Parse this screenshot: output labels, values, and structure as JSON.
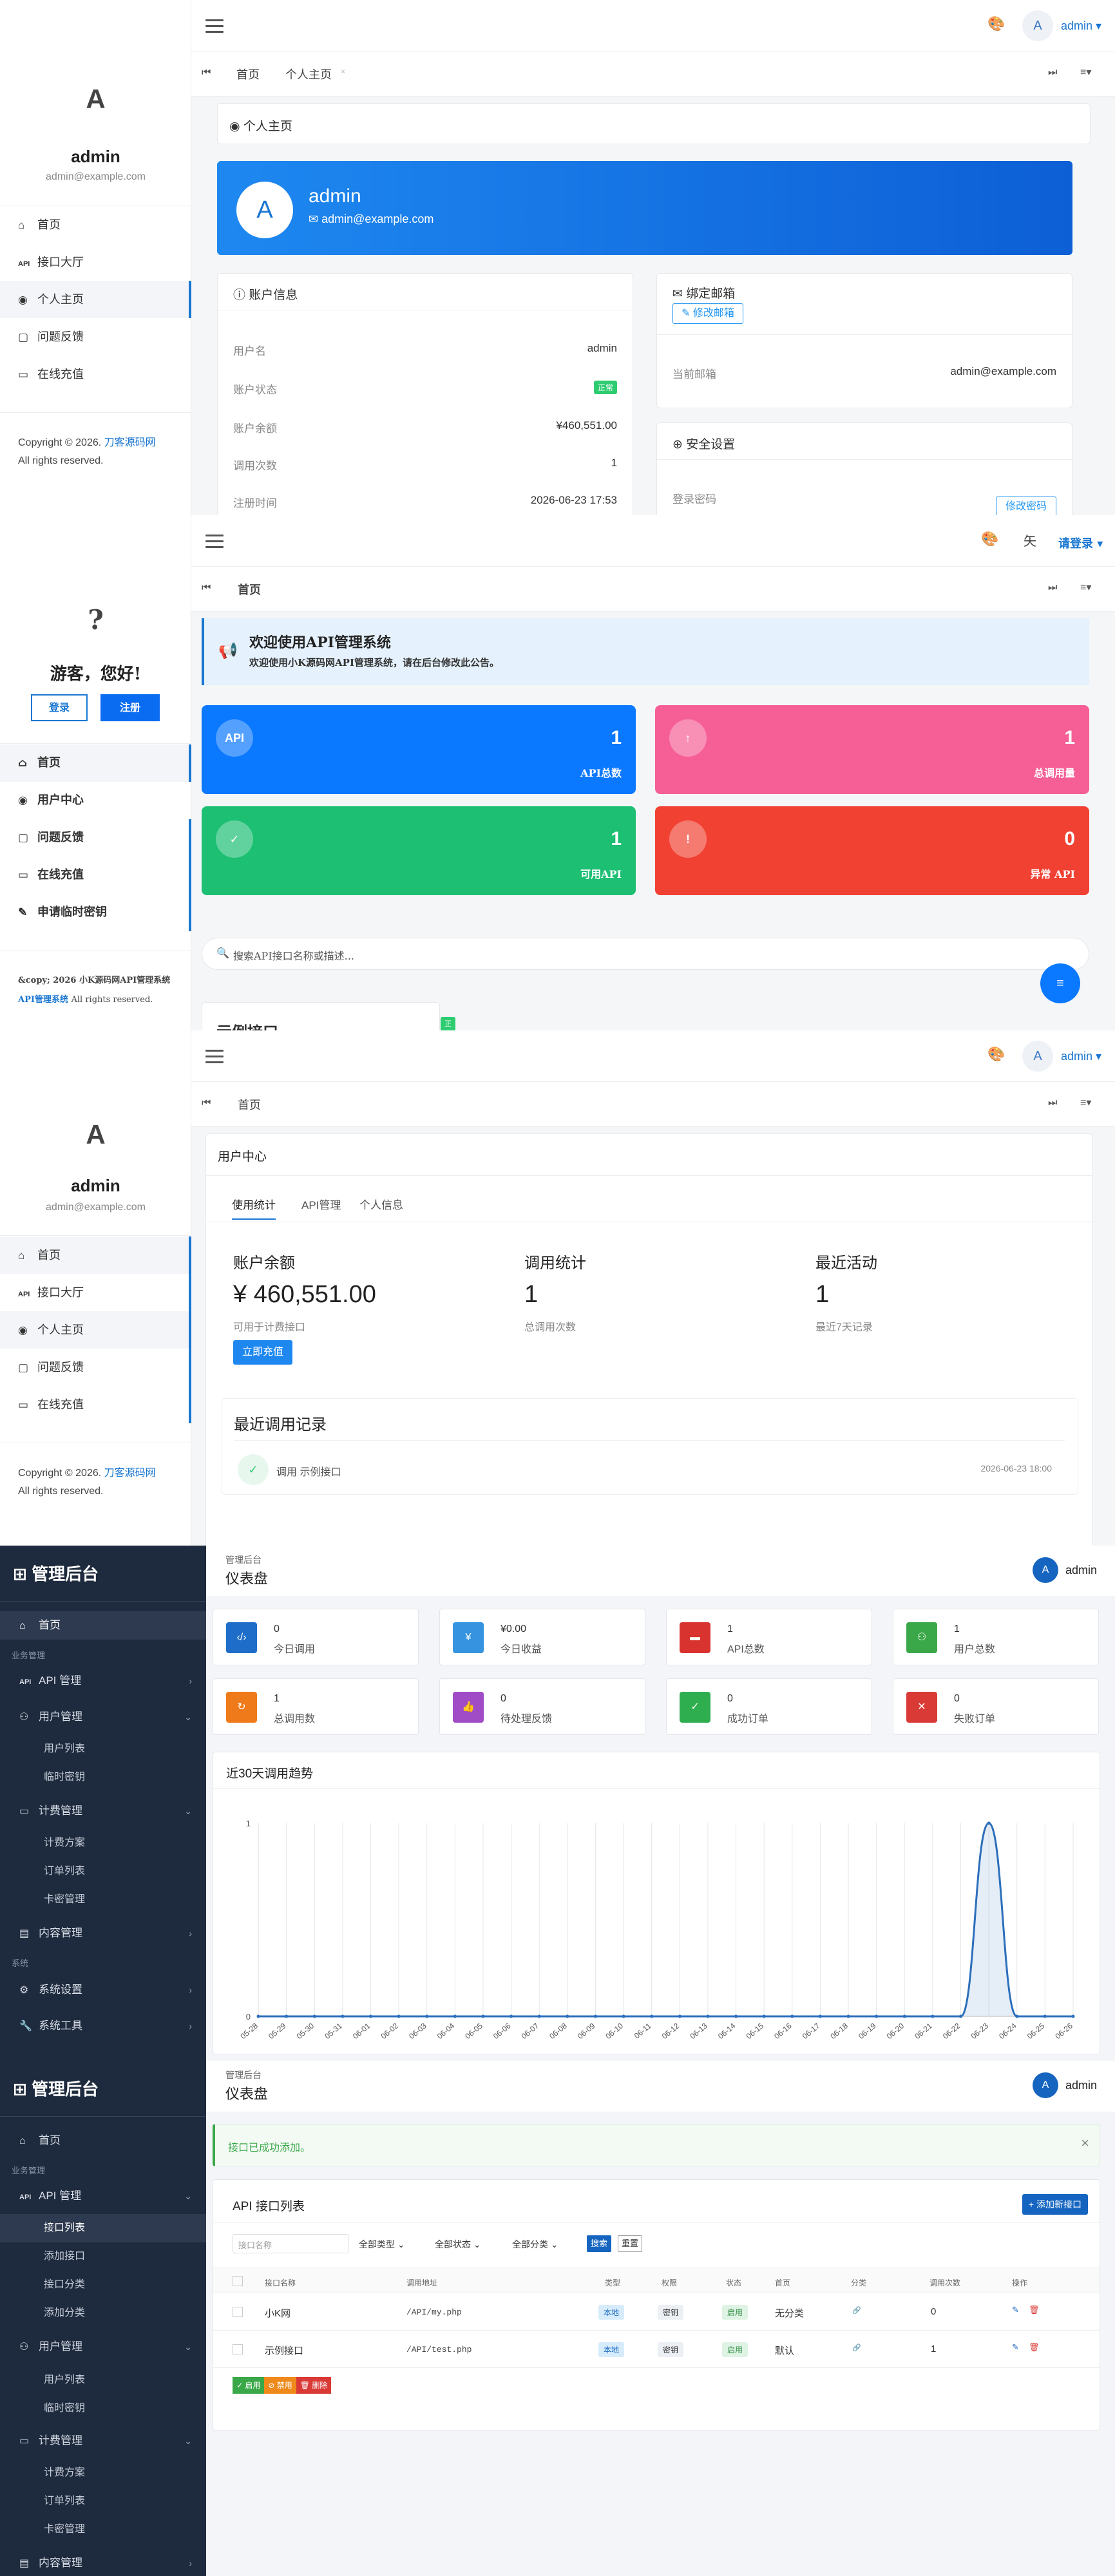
{
  "p1": {
    "side": {
      "avatar": "A",
      "name": "admin",
      "email": "admin@example.com",
      "nav": [
        {
          "icon": "⌂",
          "label": "首页"
        },
        {
          "icon": "API",
          "label": "接口大厅"
        },
        {
          "icon": "◉",
          "label": "个人主页"
        },
        {
          "icon": "▢",
          "label": "问题反馈"
        },
        {
          "icon": "▭",
          "label": "在线充值"
        }
      ],
      "footer_text": "Copyright © 2026.",
      "footer_link": "刀客源码网",
      "footer_rights": "All rights reserved."
    },
    "top": {
      "avatar": "A",
      "user": "admin ▾"
    },
    "tabs": [
      "首页",
      "个人主页"
    ],
    "page_title": "◉ 个人主页",
    "banner": {
      "avatar": "A",
      "name": "admin",
      "email": "✉ admin@example.com"
    },
    "account": {
      "title": "ⓘ 账户信息",
      "rows": [
        {
          "k": "用户名",
          "v": "admin"
        },
        {
          "k": "账户状态",
          "v": "正常"
        },
        {
          "k": "账户余额",
          "v": "¥460,551.00"
        },
        {
          "k": "调用次数",
          "v": "1"
        },
        {
          "k": "注册时间",
          "v": "2026-06-23 17:53"
        }
      ]
    },
    "email_card": {
      "title": "✉ 绑定邮箱",
      "btn": "✎ 修改邮箱",
      "k": "当前邮箱",
      "v": "admin@example.com"
    },
    "security": {
      "title": "⊕ 安全设置",
      "k": "登录密码",
      "btn": "修改密码"
    }
  },
  "p2": {
    "side": {
      "avatar": "?",
      "greet": "游客，您好!",
      "login": "登录",
      "register": "注册",
      "nav": [
        {
          "icon": "⌂",
          "label": "首页"
        },
        {
          "icon": "◉",
          "label": "用户中心"
        },
        {
          "icon": "▢",
          "label": "问题反馈"
        },
        {
          "icon": "▭",
          "label": "在线充值"
        },
        {
          "icon": "✎",
          "label": "申请临时密钥"
        }
      ],
      "footer_text": "&copy; 2026 小K源码网API管理系统",
      "footer_link": "API管理系统",
      "footer_rights": "All rights reserved."
    },
    "top": {
      "login": "请登录 ▾",
      "char": "矢"
    },
    "tabs": [
      "首页"
    ],
    "notice": {
      "title": "欢迎使用API管理系统",
      "text": "欢迎使用小K源码网API管理系统，请在后台修改此公告。"
    },
    "stats": [
      {
        "icon": "API",
        "value": "1",
        "label": "API总数",
        "color": "#0a78ff"
      },
      {
        "icon": "↑",
        "value": "1",
        "label": "总调用量",
        "color": "#f55f95"
      },
      {
        "icon": "✓",
        "value": "1",
        "label": "可用API",
        "color": "#1dbf73"
      },
      {
        "icon": "!",
        "value": "0",
        "label": "异常 API",
        "color": "#f14133"
      }
    ],
    "search_placeholder": "搜索API接口名称或描述...",
    "partial_card": {
      "title": "示例接口",
      "tag": "正常"
    }
  },
  "p3": {
    "side": {
      "avatar": "A",
      "name": "admin",
      "email": "admin@example.com",
      "nav": [
        {
          "icon": "⌂",
          "label": "首页"
        },
        {
          "icon": "API",
          "label": "接口大厅"
        },
        {
          "icon": "◉",
          "label": "个人主页"
        },
        {
          "icon": "▢",
          "label": "问题反馈"
        },
        {
          "icon": "▭",
          "label": "在线充值"
        }
      ],
      "footer_text": "Copyright © 2026.",
      "footer_link": "刀客源码网",
      "footer_rights": "All rights reserved."
    },
    "top": {
      "avatar": "A",
      "user": "admin ▾"
    },
    "tabs": [
      "首页"
    ],
    "title": "用户中心",
    "subtabs": [
      "使用统计",
      "API管理",
      "个人信息"
    ],
    "balance": {
      "label": "账户余额",
      "value": "¥ 460,551.00",
      "sub": "可用于计费接口",
      "btn": "立即充值"
    },
    "calls": {
      "label": "调用统计",
      "value": "1",
      "sub": "总调用次数"
    },
    "recent": {
      "label": "最近活动",
      "value": "1",
      "sub": "最近7天记录"
    },
    "records": {
      "title": "最近调用记录",
      "item": "调用 示例接口",
      "time": "2026-06-23 18:00"
    }
  },
  "p4": {
    "logo": "⊞ 管理后台",
    "head": {
      "bc": "管理后台",
      "title": "仪表盘",
      "user": "admin",
      "avatar": "A"
    },
    "nav": {
      "home": "首页",
      "sec1": "业务管理",
      "api": "API 管理",
      "user": "用户管理",
      "user_list": "用户列表",
      "temp_key": "临时密钥",
      "billing": "计费管理",
      "plans": "计费方案",
      "orders": "订单列表",
      "cards": "卡密管理",
      "content": "内容管理",
      "sec2": "系统",
      "settings": "系统设置",
      "tools": "系统工具"
    },
    "cards": [
      {
        "icon": "‹/›",
        "value": "0",
        "label": "今日调用",
        "color": "#1e6ec9"
      },
      {
        "icon": "¥",
        "value": "¥0.00",
        "label": "今日收益",
        "color": "#3593e0"
      },
      {
        "icon": "▬",
        "value": "1",
        "label": "API总数",
        "color": "#d8332f"
      },
      {
        "icon": "⚇",
        "value": "1",
        "label": "用户总数",
        "color": "#3aa848"
      },
      {
        "icon": "↻",
        "value": "1",
        "label": "总调用数",
        "color": "#ef7a1a"
      },
      {
        "icon": "👍",
        "value": "0",
        "label": "待处理反馈",
        "color": "#a04cc6"
      },
      {
        "icon": "✓",
        "value": "0",
        "label": "成功订单",
        "color": "#2eae4f"
      },
      {
        "icon": "✕",
        "value": "0",
        "label": "失败订单",
        "color": "#d93a36"
      }
    ],
    "chart_data": {
      "type": "area",
      "title": "近30天调用趋势",
      "xlabel": "",
      "ylabel": "",
      "categories": [
        "05-28",
        "05-29",
        "05-30",
        "05-31",
        "06-01",
        "06-02",
        "06-03",
        "06-04",
        "06-05",
        "06-06",
        "06-07",
        "06-08",
        "06-09",
        "06-10",
        "06-11",
        "06-12",
        "06-13",
        "06-14",
        "06-15",
        "06-16",
        "06-17",
        "06-18",
        "06-19",
        "06-20",
        "06-21",
        "06-22",
        "06-23",
        "06-24",
        "06-25",
        "06-26"
      ],
      "values": [
        0,
        0,
        0,
        0,
        0,
        0,
        0,
        0,
        0,
        0,
        0,
        0,
        0,
        0,
        0,
        0,
        0,
        0,
        0,
        0,
        0,
        0,
        0,
        0,
        0,
        0,
        1,
        0,
        0,
        0
      ],
      "ylim": [
        0,
        1
      ],
      "yticks": [
        "0",
        "1"
      ],
      "color": "#2c6fbb"
    }
  },
  "p5": {
    "logo": "⊞ 管理后台",
    "head": {
      "bc": "管理后台",
      "title": "仪表盘",
      "user": "admin",
      "avatar": "A"
    },
    "nav": {
      "home": "首页",
      "sec1": "业务管理",
      "api": "API 管理",
      "api_list": "接口列表",
      "api_add": "添加接口",
      "api_cat": "接口分类",
      "cat_add": "添加分类",
      "user": "用户管理",
      "user_list": "用户列表",
      "temp_key": "临时密钥",
      "billing": "计费管理",
      "plans": "计费方案",
      "orders": "订单列表",
      "cards": "卡密管理",
      "content": "内容管理"
    },
    "alert": "接口已成功添加。",
    "list": {
      "title": "API 接口列表",
      "add_btn": "+ 添加新接口",
      "name_ph": "接口名称",
      "type_sel": "全部类型",
      "status_sel": "全部状态",
      "cat_sel": "全部分类",
      "search": "搜索",
      "reset": "重置",
      "headers": [
        "接口名称",
        "调用地址",
        "类型",
        "权限",
        "状态",
        "首页",
        "分类",
        "调用次数",
        "操作"
      ],
      "rows": [
        {
          "name": "小K网",
          "url": "/API/my.php",
          "type": "本地",
          "perm": "密钥",
          "status": "启用",
          "home": "无分类",
          "cat": "🔗",
          "count": "0"
        },
        {
          "name": "示例接口",
          "url": "/API/test.php",
          "type": "本地",
          "perm": "密钥",
          "status": "启用",
          "home": "默认",
          "cat": "🔗",
          "count": "1"
        }
      ],
      "bulk": {
        "enable": "✓ 启用",
        "disable": "⊘ 禁用",
        "delete": "🗑 删除"
      }
    }
  }
}
